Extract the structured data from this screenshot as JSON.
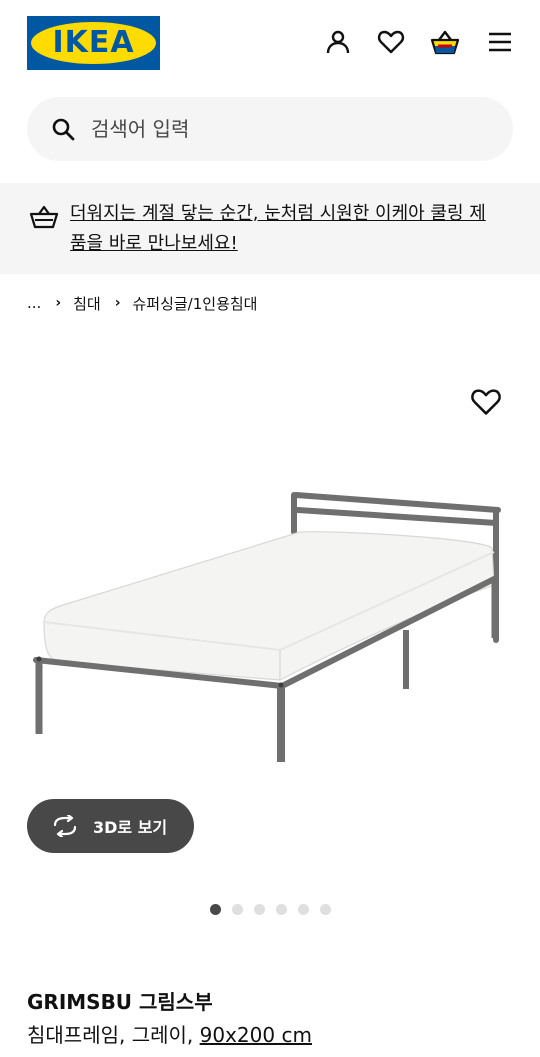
{
  "header": {
    "logo_text": "IKEA",
    "icons": [
      "account-icon",
      "heart-icon",
      "basket-icon",
      "menu-icon"
    ]
  },
  "search": {
    "placeholder": "검색어 입력"
  },
  "promo": {
    "icon": "basket-icon",
    "text": "더워지는 계절 닿는 순간, 눈처럼 시원한 이케아 쿨링 제품을 바로 만나보세요!"
  },
  "breadcrumb": {
    "items": [
      "...",
      "침대",
      "슈퍼싱글/1인용침대"
    ],
    "separator": "›"
  },
  "product": {
    "image": "bed-frame-image",
    "view3d_label": "3D로 보기",
    "carousel": {
      "total": 6,
      "active": 1
    },
    "name": "GRIMSBU 그림스부",
    "description": "침대프레임, 그레이, ",
    "size": "90x200 cm"
  },
  "colors": {
    "brand_blue": "#0058a3",
    "brand_yellow": "#ffdb00",
    "button_dark": "#484848",
    "panel_gray": "#f5f5f5"
  }
}
